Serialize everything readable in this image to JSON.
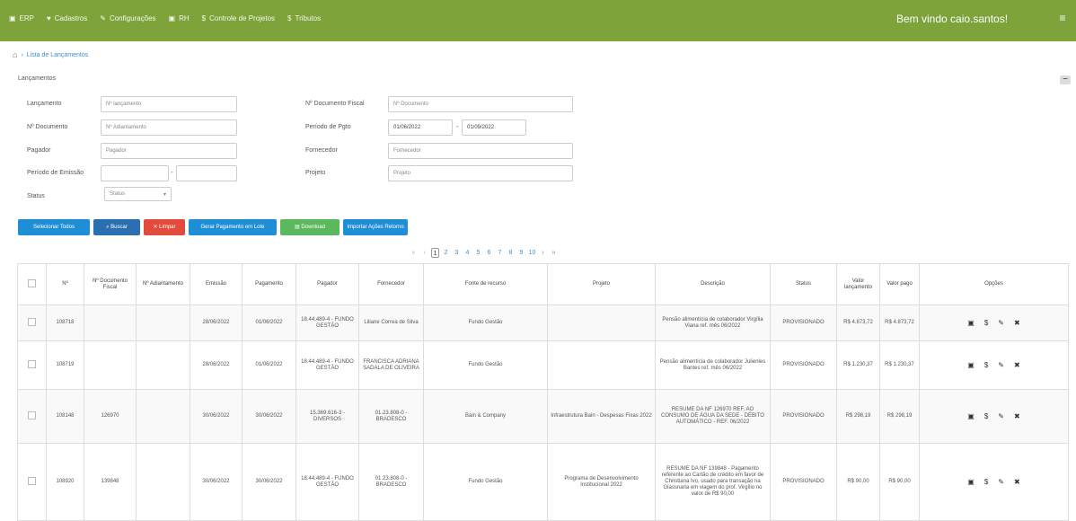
{
  "nav": {
    "items": [
      {
        "icon": "▣",
        "icon_name": "grid-icon",
        "label": "ERP"
      },
      {
        "icon": "♥",
        "icon_name": "box-icon",
        "label": "Cadastros"
      },
      {
        "icon": "✎",
        "icon_name": "wrench-icon",
        "label": "Configurações"
      },
      {
        "icon": "▣",
        "icon_name": "grid-icon",
        "label": "RH"
      },
      {
        "icon": "$",
        "icon_name": "dollar-icon",
        "label": "Controle de Projetos"
      },
      {
        "icon": "$",
        "icon_name": "dollar-icon",
        "label": "Tributos"
      }
    ],
    "welcome": "Bem vindo caio.santos!",
    "toggle": "≡"
  },
  "breadcrumb": {
    "home": "⌂",
    "sep": "›",
    "page": "Lista de Lançamentos"
  },
  "panel": {
    "title": "Lançamentos",
    "collapse": "−"
  },
  "form": {
    "lancamento": {
      "label": "Lançamento",
      "placeholder": "Nº lançamento"
    },
    "documento": {
      "label": "Nº Documento",
      "placeholder": "Nº Adiantamento"
    },
    "pagador": {
      "label": "Pagador",
      "placeholder": "Pagador"
    },
    "periodo_emissao": {
      "label": "Período de Emissão",
      "from": "",
      "to": ""
    },
    "status": {
      "label": "Status",
      "value": "Status"
    },
    "doc_fiscal": {
      "label": "Nº Documento Fiscal",
      "placeholder": "Nº Documento"
    },
    "periodo_pgto": {
      "label": "Período de Pgto",
      "from": "01/06/2022",
      "to": "01/09/2022"
    },
    "fornecedor": {
      "label": "Fornecedor",
      "placeholder": "Fornecedor"
    },
    "projeto": {
      "label": "Projeto",
      "placeholder": "Projeto"
    }
  },
  "buttons": {
    "selecionar": "Selecionar Todos",
    "buscar": "Buscar",
    "limpar": "Limpar",
    "gerar": "Gerar Pagamento em Lote",
    "download": "Download",
    "importar": "Importar Ações Retorno"
  },
  "pagination": {
    "first": "«",
    "prev": "‹",
    "pages": [
      "1",
      "2",
      "3",
      "4",
      "5",
      "6",
      "7",
      "8",
      "9",
      "10"
    ],
    "active": "1",
    "next": "›",
    "last": "»"
  },
  "table": {
    "headers": [
      "",
      "Nº",
      "Nº Documento Fiscal",
      "Nº Adiantamento",
      "Emissão",
      "Pagamento",
      "Pagador",
      "Fornecedor",
      "Fonte de recurso",
      "Projeto",
      "Descrição",
      "Status",
      "Valor lançamento",
      "Valor pago",
      "Opções"
    ],
    "rows": [
      {
        "num": "108718",
        "doc_fiscal": "",
        "adiant": "",
        "emissao": "28/06/2022",
        "pagamento": "01/06/2022",
        "pagador": "18.44.489-4 - FUNDO GESTÃO",
        "fornecedor": "Liliane Correa de Silva",
        "fonte": "Fundo Gestão",
        "projeto": "",
        "descricao": "Pensão alimentícia de colaborador Virgília Viana ref. mês 06/2022",
        "status": "PROVISIONADO",
        "valor_lanc": "R$ 4.873,72",
        "valor_pago": "R$ 4.873,72"
      },
      {
        "num": "108719",
        "doc_fiscal": "",
        "adiant": "",
        "emissao": "28/06/2022",
        "pagamento": "01/06/2022",
        "pagador": "18.44.489-4 - FUNDO GESTÃO",
        "fornecedor": "FRANCISCA ADRIANA SADALA DE OLIVEIRA",
        "fonte": "Fundo Gestão",
        "projeto": "",
        "descricao": "Pensão alimentícia de colaborador Julienles Bantes ref. mês 06/2022",
        "status": "PROVISIONADO",
        "valor_lanc": "R$ 1.230,37",
        "valor_pago": "R$ 1.230,37"
      },
      {
        "num": "108148",
        "doc_fiscal": "126970",
        "adiant": "",
        "emissao": "30/06/2022",
        "pagamento": "30/06/2022",
        "pagador": "15.369.616-3 - DIVERSOS",
        "fornecedor": "01.23.808-0 - BRADESCO",
        "fonte": "Bain & Company",
        "projeto": "Infraestrutura Bain - Despesas Fixas 2022",
        "descricao": "RESUME DA NF 126970 REF. AO CONSUMO DE ÁGUA DA SEDE - DÉBITO AUTOMÁTICO - REF. 06/2022",
        "status": "PROVISIONADO",
        "valor_lanc": "R$ 298,19",
        "valor_pago": "R$ 298,19"
      },
      {
        "num": "108920",
        "doc_fiscal": "139848",
        "adiant": "",
        "emissao": "30/06/2022",
        "pagamento": "30/06/2022",
        "pagador": "18.44.489-4 - FUNDO GESTÃO",
        "fornecedor": "01.23.808-0 - BRADESCO",
        "fonte": "Fundo Gestão",
        "projeto": "Programa de Desenvolvimento Institucional 2022",
        "descricao": "RESUME DA NF 139848 - Pagamento referente ao Cartão de crédito em favor de Christiana Ivo, usado para transação na Glassnaria em viagem do prof. Virgílio no valor de R$ 90,00",
        "status": "PROVISIONADO",
        "valor_lanc": "R$ 90,00",
        "valor_pago": "R$ 90,00"
      }
    ]
  }
}
